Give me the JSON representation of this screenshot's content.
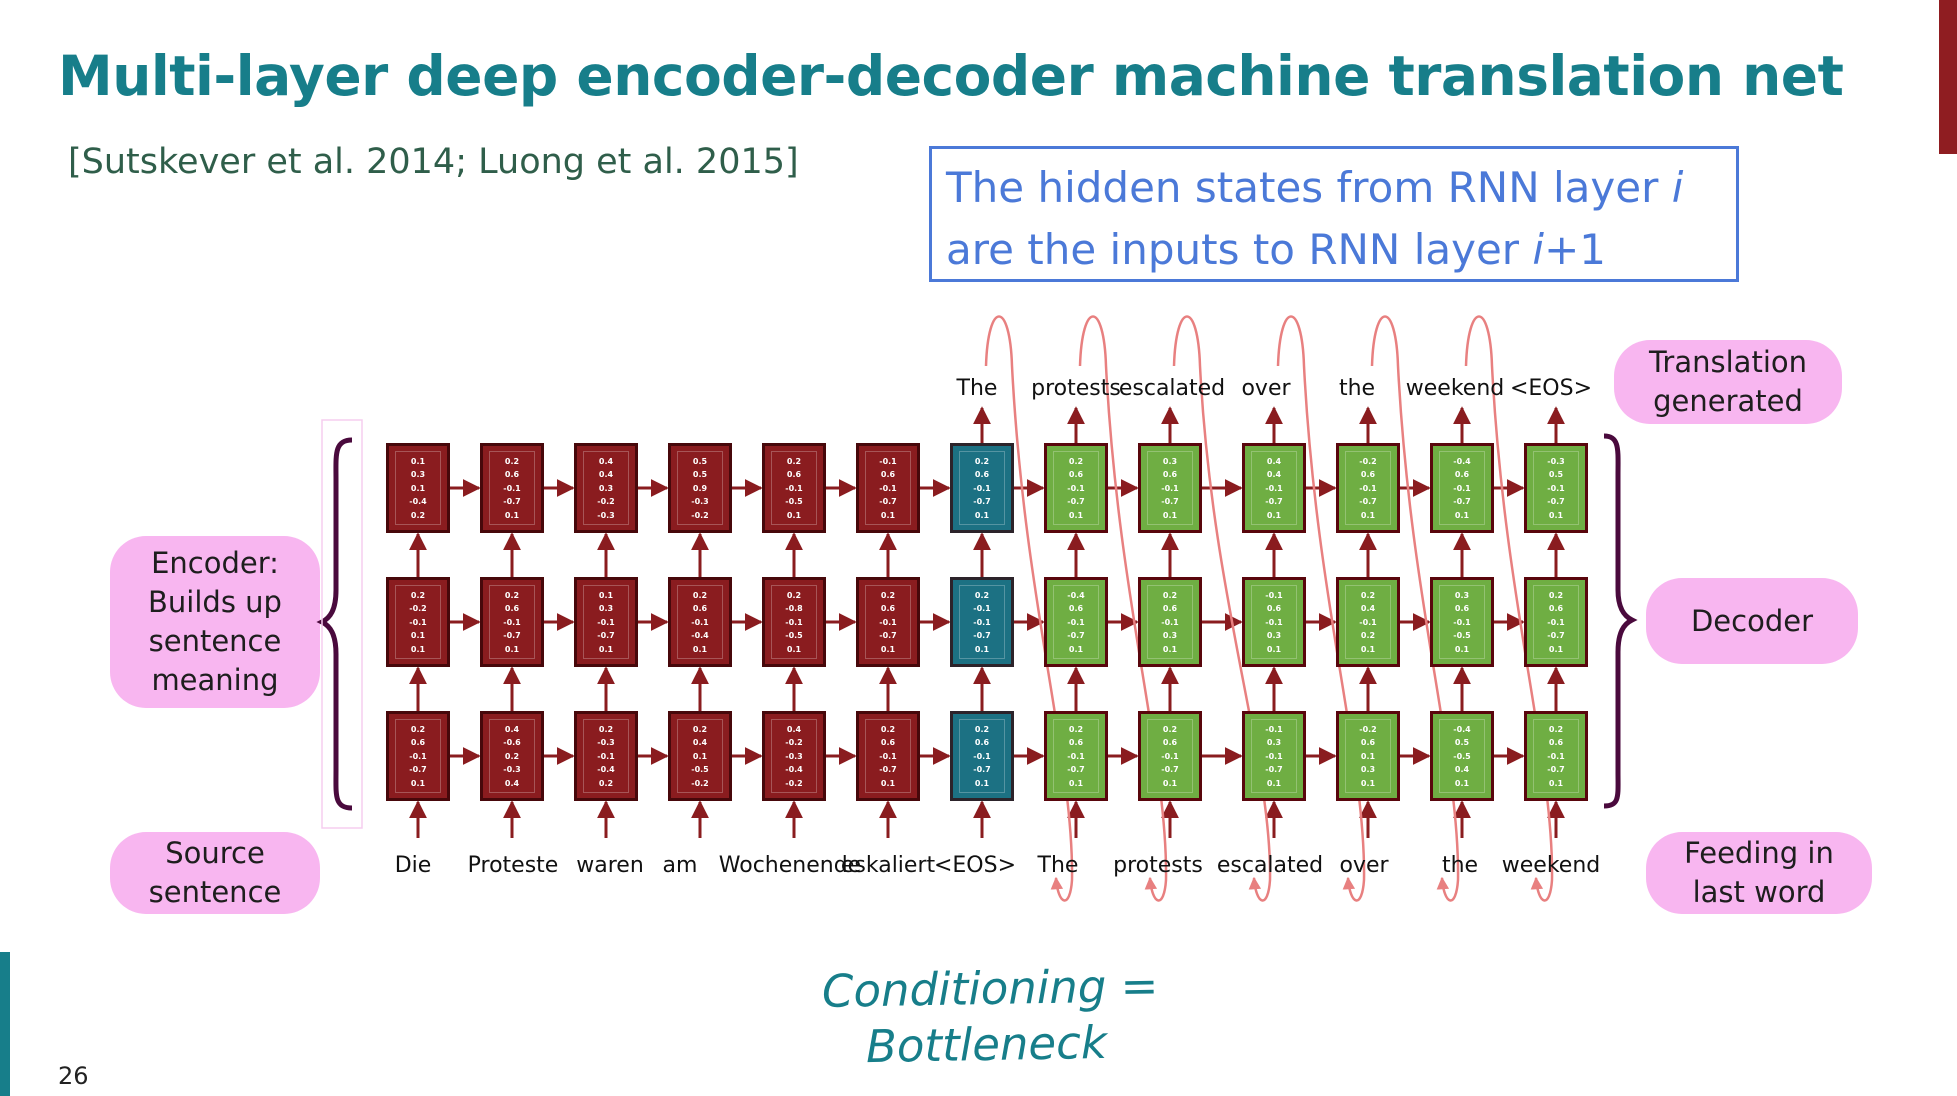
{
  "slide": {
    "title": "Multi-layer deep encoder-decoder machine translation net",
    "subtitle": "[Sutskever et al. 2014; Luong et al. 2015]",
    "page_number": "26"
  },
  "callout": {
    "line1_prefix": "The hidden states from RNN layer ",
    "line1_var": "i",
    "line2_prefix": "are the inputs to RNN layer ",
    "line2_var": "i",
    "line2_suffix": "+1"
  },
  "labels": {
    "encoder": [
      "Encoder:",
      "Builds up",
      "sentence",
      "meaning"
    ],
    "source": [
      "Source",
      "sentence"
    ],
    "translation": [
      "Translation",
      "generated"
    ],
    "decoder": [
      "Decoder"
    ],
    "feeding": [
      "Feeding in",
      "last word"
    ]
  },
  "handwritten_note": {
    "line1": "Conditioning =",
    "line2": "Bottleneck"
  },
  "colors": {
    "title": "#177e8a",
    "encoder_cell": "#8a1c1f",
    "bottleneck_cell": "#1c7183",
    "decoder_cell": "#6fae43",
    "arrow": "#8a1c1f",
    "feed_loop": "#e88080",
    "callout": "#4b79d8",
    "label_bubble": "#f8b6f0",
    "brace": "#4a0a3d"
  },
  "source_words": [
    "Die",
    "Proteste",
    "waren",
    "am",
    "Wochenende",
    "eskaliert",
    "<EOS>",
    "The",
    "protests",
    "escalated",
    "over",
    "the",
    "weekend"
  ],
  "output_words": [
    "The",
    "protests",
    "escalated",
    "over",
    "the",
    "weekend",
    "<EOS>"
  ],
  "columns": [
    {
      "type": "enc",
      "layers": [
        [
          "0.1",
          "0.3",
          "0.1",
          "-0.4",
          "0.2"
        ],
        [
          "0.2",
          "-0.2",
          "-0.1",
          "0.1",
          "0.1"
        ],
        [
          "0.2",
          "0.6",
          "-0.1",
          "-0.7",
          "0.1"
        ]
      ]
    },
    {
      "type": "enc",
      "layers": [
        [
          "0.2",
          "0.6",
          "-0.1",
          "-0.7",
          "0.1"
        ],
        [
          "0.2",
          "0.6",
          "-0.1",
          "-0.7",
          "0.1"
        ],
        [
          "0.4",
          "-0.6",
          "0.2",
          "-0.3",
          "0.4"
        ]
      ]
    },
    {
      "type": "enc",
      "layers": [
        [
          "0.4",
          "0.4",
          "0.3",
          "-0.2",
          "-0.3"
        ],
        [
          "0.1",
          "0.3",
          "-0.1",
          "-0.7",
          "0.1"
        ],
        [
          "0.2",
          "-0.3",
          "-0.1",
          "-0.4",
          "0.2"
        ]
      ]
    },
    {
      "type": "enc",
      "layers": [
        [
          "0.5",
          "0.5",
          "0.9",
          "-0.3",
          "-0.2"
        ],
        [
          "0.2",
          "0.6",
          "-0.1",
          "-0.4",
          "0.1"
        ],
        [
          "0.2",
          "0.4",
          "0.1",
          "-0.5",
          "-0.2"
        ]
      ]
    },
    {
      "type": "enc",
      "layers": [
        [
          "0.2",
          "0.6",
          "-0.1",
          "-0.5",
          "0.1"
        ],
        [
          "0.2",
          "-0.8",
          "-0.1",
          "-0.5",
          "0.1"
        ],
        [
          "0.4",
          "-0.2",
          "-0.3",
          "-0.4",
          "-0.2"
        ]
      ]
    },
    {
      "type": "enc",
      "layers": [
        [
          "-0.1",
          "0.6",
          "-0.1",
          "-0.7",
          "0.1"
        ],
        [
          "0.2",
          "0.6",
          "-0.1",
          "-0.7",
          "0.1"
        ],
        [
          "0.2",
          "0.6",
          "-0.1",
          "-0.7",
          "0.1"
        ]
      ]
    },
    {
      "type": "bot",
      "layers": [
        [
          "0.2",
          "0.6",
          "-0.1",
          "-0.7",
          "0.1"
        ],
        [
          "0.2",
          "-0.1",
          "-0.1",
          "-0.7",
          "0.1"
        ],
        [
          "0.2",
          "0.6",
          "-0.1",
          "-0.7",
          "0.1"
        ]
      ]
    },
    {
      "type": "dec",
      "layers": [
        [
          "0.2",
          "0.6",
          "-0.1",
          "-0.7",
          "0.1"
        ],
        [
          "-0.4",
          "0.6",
          "-0.1",
          "-0.7",
          "0.1"
        ],
        [
          "0.2",
          "0.6",
          "-0.1",
          "-0.7",
          "0.1"
        ]
      ]
    },
    {
      "type": "dec",
      "layers": [
        [
          "0.3",
          "0.6",
          "-0.1",
          "-0.7",
          "0.1"
        ],
        [
          "0.2",
          "0.6",
          "-0.1",
          "0.3",
          "0.1"
        ],
        [
          "0.2",
          "0.6",
          "-0.1",
          "-0.7",
          "0.1"
        ]
      ]
    },
    {
      "type": "dec",
      "layers": [
        [
          "0.4",
          "0.4",
          "-0.1",
          "-0.7",
          "0.1"
        ],
        [
          "-0.1",
          "0.6",
          "-0.1",
          "0.3",
          "0.1"
        ],
        [
          "-0.1",
          "0.3",
          "-0.1",
          "-0.7",
          "0.1"
        ]
      ]
    },
    {
      "type": "dec",
      "layers": [
        [
          "-0.2",
          "0.6",
          "-0.1",
          "-0.7",
          "0.1"
        ],
        [
          "0.2",
          "0.4",
          "-0.1",
          "0.2",
          "0.1"
        ],
        [
          "-0.2",
          "0.6",
          "0.1",
          "0.3",
          "0.1"
        ]
      ]
    },
    {
      "type": "dec",
      "layers": [
        [
          "-0.4",
          "0.6",
          "-0.1",
          "-0.7",
          "0.1"
        ],
        [
          "0.3",
          "0.6",
          "-0.1",
          "-0.5",
          "0.1"
        ],
        [
          "-0.4",
          "0.5",
          "-0.5",
          "0.4",
          "0.1"
        ]
      ]
    },
    {
      "type": "dec",
      "layers": [
        [
          "-0.3",
          "0.5",
          "-0.1",
          "-0.7",
          "0.1"
        ],
        [
          "0.2",
          "0.6",
          "-0.1",
          "-0.7",
          "0.1"
        ],
        [
          "0.2",
          "0.6",
          "-0.1",
          "-0.7",
          "0.1"
        ]
      ]
    }
  ]
}
